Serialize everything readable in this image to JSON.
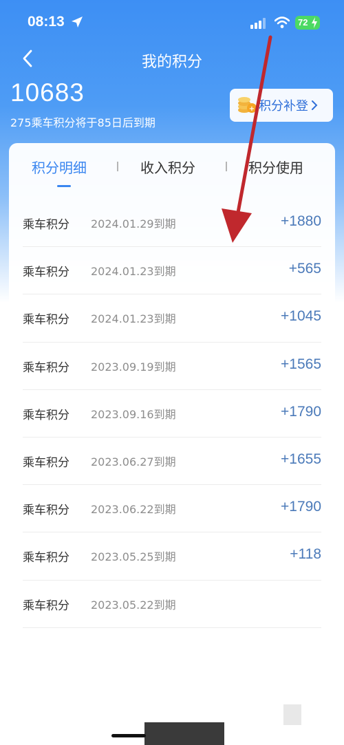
{
  "status": {
    "time": "08:13",
    "battery": "72"
  },
  "nav": {
    "title": "我的积分"
  },
  "summary": {
    "total": "10683",
    "note": "275乘车积分将于85日后到期",
    "makeup_label": "积分补登"
  },
  "tabs": [
    {
      "label": "积分明细"
    },
    {
      "label": "收入积分"
    },
    {
      "label": "积分使用"
    }
  ],
  "records": [
    {
      "type": "乘车积分",
      "date": "2024.01.29到期",
      "amount": "+1880"
    },
    {
      "type": "乘车积分",
      "date": "2024.01.23到期",
      "amount": "+565"
    },
    {
      "type": "乘车积分",
      "date": "2024.01.23到期",
      "amount": "+1045"
    },
    {
      "type": "乘车积分",
      "date": "2023.09.19到期",
      "amount": "+1565"
    },
    {
      "type": "乘车积分",
      "date": "2023.09.16到期",
      "amount": "+1790"
    },
    {
      "type": "乘车积分",
      "date": "2023.06.27到期",
      "amount": "+1655"
    },
    {
      "type": "乘车积分",
      "date": "2023.06.22到期",
      "amount": "+1790"
    },
    {
      "type": "乘车积分",
      "date": "2023.05.25到期",
      "amount": "+118"
    },
    {
      "type": "乘车积分",
      "date": "2023.05.22到期",
      "amount": ""
    }
  ],
  "colors": {
    "accent": "#3a86f0",
    "header_blue": "#3d8ff4",
    "amount": "#4b7ab9",
    "annotation_arrow": "#c0282d"
  },
  "icons": {
    "back": "chevron-left-icon",
    "location": "location-arrow-icon",
    "signal": "cellular-signal-icon",
    "wifi": "wifi-icon",
    "coin": "coin-stack-icon"
  }
}
